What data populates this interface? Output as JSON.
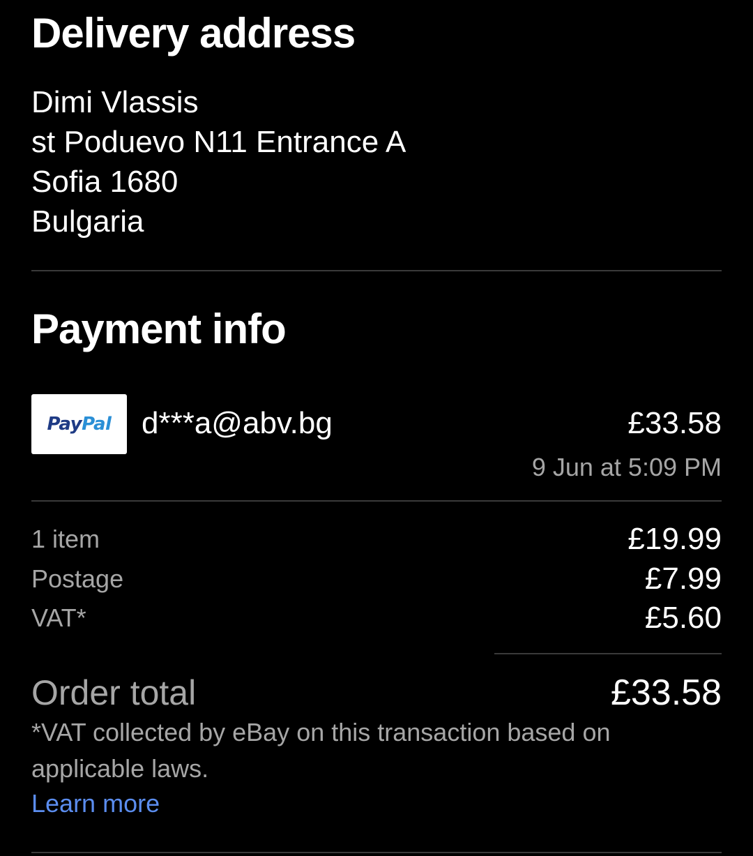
{
  "delivery": {
    "heading": "Delivery address",
    "name": "Dimi Vlassis",
    "street": "st Poduevo N11 Entrance A",
    "city_postcode": "Sofia 1680",
    "country": "Bulgaria"
  },
  "payment": {
    "heading": "Payment info",
    "method_logo": {
      "part1": "Pay",
      "part2": "Pal",
      "icon": "paypal-logo"
    },
    "email": "d***a@abv.bg",
    "amount": "£33.58",
    "date": "9 Jun at 5:09 PM"
  },
  "summary": {
    "rows": [
      {
        "label": "1 item",
        "value": "£19.99"
      },
      {
        "label": "Postage",
        "value": "£7.99"
      },
      {
        "label": "VAT*",
        "value": "£5.60"
      }
    ],
    "total_label": "Order total",
    "total_value": "£33.58",
    "vat_note": "*VAT collected by eBay on this transaction based on applicable laws.",
    "learn_more": "Learn more"
  },
  "colors": {
    "background": "#000000",
    "text_primary": "#ffffff",
    "text_secondary": "#a6a6a6",
    "link": "#5b8def",
    "divider": "#3a3a3a",
    "paypal_dark": "#1f3b85",
    "paypal_light": "#2a8fd6"
  }
}
